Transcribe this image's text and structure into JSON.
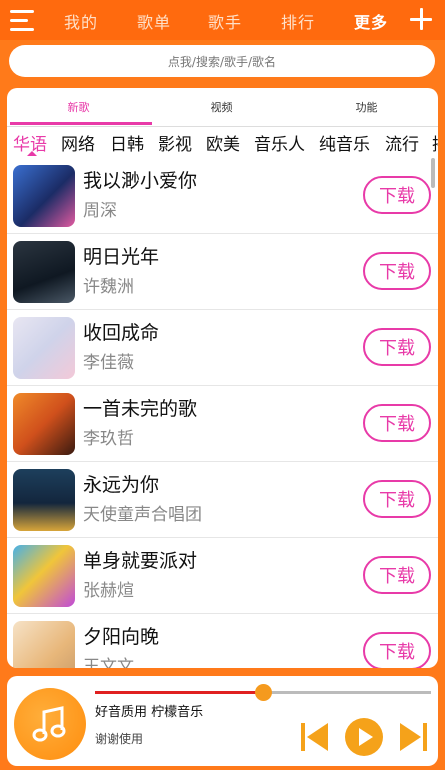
{
  "nav": {
    "items": [
      "我的",
      "歌单",
      "歌手",
      "排行",
      "更多"
    ],
    "active_index": 4
  },
  "search": {
    "placeholder": "点我/搜索/歌手/歌名"
  },
  "tabs": [
    "新歌",
    "视频",
    "功能"
  ],
  "categories": [
    "华语",
    "网络",
    "日韩",
    "影视",
    "欧美",
    "音乐人",
    "纯音乐",
    "流行",
    "摇"
  ],
  "songs": [
    {
      "title": "我以渺小爱你",
      "artist": "周深",
      "download": "下载"
    },
    {
      "title": "明日光年",
      "artist": "许魏洲",
      "download": "下载"
    },
    {
      "title": "收回成命",
      "artist": "李佳薇",
      "download": "下载"
    },
    {
      "title": "一首未完的歌",
      "artist": "李玖哲",
      "download": "下载"
    },
    {
      "title": "永远为你",
      "artist": "天使童声合唱团",
      "download": "下载"
    },
    {
      "title": "单身就要派对",
      "artist": "张赫煊",
      "download": "下载"
    },
    {
      "title": "夕阳向晚",
      "artist": "王文文",
      "download": "下载"
    }
  ],
  "player": {
    "title": "好音质用 柠檬音乐",
    "subtitle": "谢谢使用",
    "progress": 0.5
  },
  "colors": {
    "brand": "#ff6a0e",
    "accent": "#e83aa8",
    "player_accent": "#f59a1e"
  }
}
